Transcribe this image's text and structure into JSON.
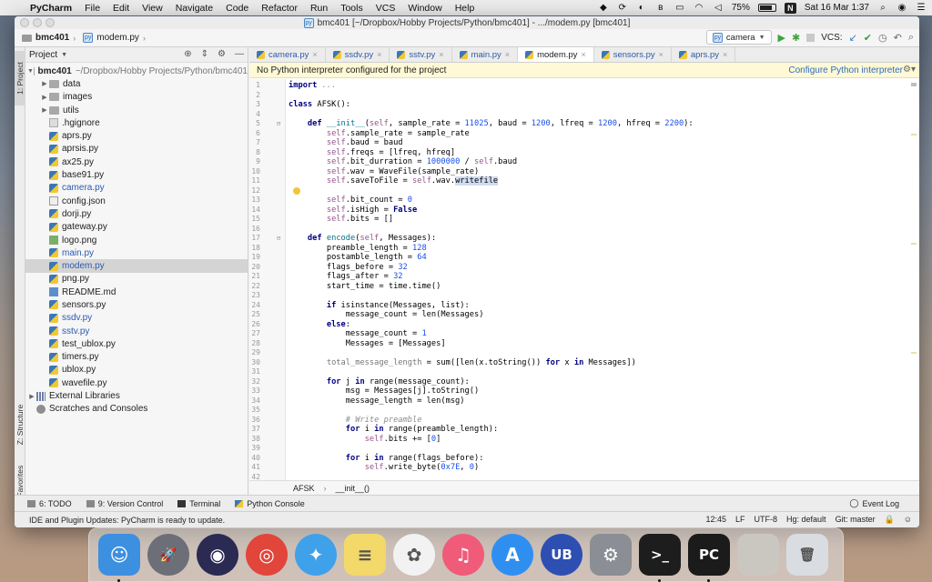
{
  "menubar": {
    "app_name": "PyCharm",
    "items": [
      "File",
      "Edit",
      "View",
      "Navigate",
      "Code",
      "Refactor",
      "Run",
      "Tools",
      "VCS",
      "Window",
      "Help"
    ],
    "battery": "75%",
    "clock": "Sat 16 Mar  1:37"
  },
  "window": {
    "title": "bmc401 [~/Dropbox/Hobby Projects/Python/bmc401] - .../modem.py [bmc401]"
  },
  "navbar": {
    "project": "bmc401",
    "file": "modem.py",
    "run_config": "camera",
    "vcs_label": "VCS:"
  },
  "stripe": {
    "project_tab": "1: Project",
    "structure_tab": "Z: Structure",
    "favorites_tab": "2: Favorites"
  },
  "project_panel": {
    "header": "Project",
    "root_name": "bmc401",
    "root_path": "~/Dropbox/Hobby Projects/Python/bmc401",
    "items": [
      {
        "name": "data",
        "kind": "folder",
        "color": "normal"
      },
      {
        "name": "images",
        "kind": "folder",
        "color": "normal"
      },
      {
        "name": "utils",
        "kind": "folder",
        "color": "normal"
      },
      {
        "name": ".hgignore",
        "kind": "generic",
        "color": "normal"
      },
      {
        "name": "aprs.py",
        "kind": "py",
        "color": "normal"
      },
      {
        "name": "aprsis.py",
        "kind": "py",
        "color": "normal"
      },
      {
        "name": "ax25.py",
        "kind": "py",
        "color": "normal"
      },
      {
        "name": "base91.py",
        "kind": "py",
        "color": "normal"
      },
      {
        "name": "camera.py",
        "kind": "py",
        "color": "blue"
      },
      {
        "name": "config.json",
        "kind": "json",
        "color": "normal"
      },
      {
        "name": "dorji.py",
        "kind": "py",
        "color": "normal"
      },
      {
        "name": "gateway.py",
        "kind": "py",
        "color": "normal"
      },
      {
        "name": "logo.png",
        "kind": "img",
        "color": "normal"
      },
      {
        "name": "main.py",
        "kind": "py",
        "color": "blue"
      },
      {
        "name": "modem.py",
        "kind": "py",
        "color": "blue",
        "selected": true
      },
      {
        "name": "png.py",
        "kind": "py",
        "color": "normal"
      },
      {
        "name": "README.md",
        "kind": "md",
        "color": "normal"
      },
      {
        "name": "sensors.py",
        "kind": "py",
        "color": "normal"
      },
      {
        "name": "ssdv.py",
        "kind": "py",
        "color": "blue"
      },
      {
        "name": "sstv.py",
        "kind": "py",
        "color": "blue"
      },
      {
        "name": "test_ublox.py",
        "kind": "py",
        "color": "normal"
      },
      {
        "name": "timers.py",
        "kind": "py",
        "color": "normal"
      },
      {
        "name": "ublox.py",
        "kind": "py",
        "color": "normal"
      },
      {
        "name": "wavefile.py",
        "kind": "py",
        "color": "normal"
      }
    ],
    "external_libraries": "External Libraries",
    "scratches": "Scratches and Consoles"
  },
  "editor": {
    "tabs": [
      {
        "label": "camera.py",
        "active": false
      },
      {
        "label": "ssdv.py",
        "active": false
      },
      {
        "label": "sstv.py",
        "active": false
      },
      {
        "label": "main.py",
        "active": false
      },
      {
        "label": "modem.py",
        "active": true
      },
      {
        "label": "sensors.py",
        "active": false
      },
      {
        "label": "aprs.py",
        "active": false
      }
    ],
    "banner_text": "No Python interpreter configured for the project",
    "banner_link": "Configure Python interpreter",
    "breadcrumb": [
      "AFSK",
      "__init__()"
    ],
    "lines": [
      "<span class=\"kw\">import</span> <span class=\"cm\">...</span>",
      "",
      "<span class=\"kw\">class</span> AFSK():",
      "",
      "    <span class=\"kw\">def</span> <span class=\"fn\">__init__</span>(<span class=\"sf\">self</span>, sample_rate = <span class=\"num\">11025</span>, baud = <span class=\"num\">1200</span>, lfreq = <span class=\"num\">1200</span>, hfreq = <span class=\"num\">2200</span>):",
      "        <span class=\"sf\">self</span>.sample_rate = sample_rate",
      "        <span class=\"sf\">self</span>.baud = baud",
      "        <span class=\"sf\">self</span>.freqs = [lfreq, hfreq]",
      "        <span class=\"sf\">self</span>.bit_durration = <span class=\"num\">1000000</span> / <span class=\"sf\">self</span>.baud",
      "        <span class=\"sf\">self</span>.wav = WaveFile(sample_rate)",
      "        <span class=\"sf\">self</span>.saveToFile = <span class=\"sf\">self</span>.wav.<span class=\"sel\">writefile</span>",
      "",
      "        <span class=\"sf\">self</span>.bit_count = <span class=\"num\">0</span>",
      "        <span class=\"sf\">self</span>.isHigh = <span class=\"kw\">False</span>",
      "        <span class=\"sf\">self</span>.bits = []",
      "",
      "    <span class=\"kw\">def</span> <span class=\"fn\">encode</span>(<span class=\"sf\">self</span>, Messages):",
      "        preamble_length = <span class=\"num\">128</span>",
      "        postamble_length = <span class=\"num\">64</span>",
      "        flags_before = <span class=\"num\">32</span>",
      "        flags_after = <span class=\"num\">32</span>",
      "        start_time = time.time()",
      "",
      "        <span class=\"kw\">if</span> isinstance(Messages, list):",
      "            message_count = len(Messages)",
      "        <span class=\"kw\">else</span>:",
      "            message_count = <span class=\"num\">1</span>",
      "            Messages = [Messages]",
      "",
      "        <span class=\"muted\">total_message_length</span> = sum([len(x.toString()) <span class=\"kw\">for</span> x <span class=\"kw\">in</span> Messages])",
      "",
      "        <span class=\"kw\">for</span> j <span class=\"kw\">in</span> range(message_count):",
      "            msg = Messages[j].toString()",
      "            message_length = len(msg)",
      "",
      "            <span class=\"cm\"># Write preamble</span>",
      "            <span class=\"kw\">for</span> i <span class=\"kw\">in</span> range(preamble_length):",
      "                <span class=\"sf\">self</span>.bits += [<span class=\"num\">0</span>]",
      "",
      "            <span class=\"kw\">for</span> i <span class=\"kw\">in</span> range(flags_before):",
      "                <span class=\"sf\">self</span>.write_byte(<span class=\"num\">0x7E</span>, <span class=\"num\">0</span>)"
    ],
    "line_numbers": [
      "1",
      "2",
      "3",
      "4",
      "5",
      "6",
      "7",
      "8",
      "9",
      "10",
      "11",
      "12",
      "13",
      "14",
      "15",
      "16",
      "17",
      "18",
      "19",
      "20",
      "21",
      "22",
      "23",
      "24",
      "25",
      "26",
      "27",
      "28",
      "29",
      "30",
      "31",
      "32",
      "33",
      "34",
      "35",
      "36",
      "37",
      "38",
      "39",
      "40",
      "41",
      "42"
    ]
  },
  "bottom_tools": {
    "todo": "6: TODO",
    "version_control": "9: Version Control",
    "terminal": "Terminal",
    "python_console": "Python Console",
    "event_log": "Event Log"
  },
  "status": {
    "message": "IDE and Plugin Updates: PyCharm is ready to update.",
    "position": "12:45",
    "line_sep": "LF",
    "encoding": "UTF-8",
    "hg": "Hg: default",
    "git": "Git: master"
  },
  "dock": {
    "apps": [
      {
        "name": "finder-icon",
        "color": "#3d8fe0",
        "label": "☺"
      },
      {
        "name": "launchpad-icon",
        "color": "#6d6f78",
        "label": "🚀"
      },
      {
        "name": "siri-icon",
        "color": "#2a2a52",
        "label": "◉"
      },
      {
        "name": "chrome-icon",
        "color": "#e2453a",
        "label": "◎"
      },
      {
        "name": "safari-icon",
        "color": "#3fa1ea",
        "label": "✦"
      },
      {
        "name": "notes-icon",
        "color": "#f3d86a",
        "label": "≡"
      },
      {
        "name": "photos-icon",
        "color": "#f2f2f2",
        "label": "✿"
      },
      {
        "name": "music-icon",
        "color": "#f05b7a",
        "label": "♫"
      },
      {
        "name": "appstore-icon",
        "color": "#2f8ff1",
        "label": "A"
      },
      {
        "name": "ub-icon",
        "color": "#2e4fb2",
        "label": "UB"
      },
      {
        "name": "settings-icon",
        "color": "#8b8e94",
        "label": "⚙"
      },
      {
        "name": "terminal-icon",
        "color": "#1d1d1d",
        "label": ">_"
      },
      {
        "name": "pycharm-icon",
        "color": "#1b1b1b",
        "label": "PC"
      },
      {
        "name": "photo-thumb-icon",
        "color": "#c9c7bf",
        "label": ""
      },
      {
        "name": "trash-icon",
        "color": "#d9dde2",
        "label": "🗑"
      }
    ]
  }
}
